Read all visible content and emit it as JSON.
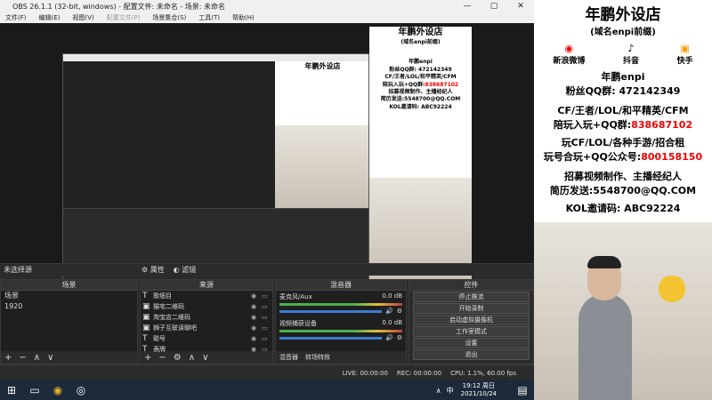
{
  "window": {
    "title": "OBS 26.1.1 (32-bit, windows) - 配置文件: 未命名 - 场景: 未命名",
    "minimize": "—",
    "maximize": "▢",
    "close": "✕"
  },
  "menu": [
    "文件(F)",
    "编辑(E)",
    "视图(V)",
    "配置文件(P)",
    "场景集合(S)",
    "工具(T)",
    "帮助(H)"
  ],
  "status_strip": {
    "no_source": "未选择源",
    "properties": "属性",
    "filters": "滤镜"
  },
  "scenes": {
    "title": "场景",
    "items": [
      "场景",
      "1920"
    ]
  },
  "sources": {
    "title": "来源",
    "items": [
      {
        "icon": "T",
        "label": "歌细目"
      },
      {
        "icon": "▣",
        "label": "猫宅二维码"
      },
      {
        "icon": "▣",
        "label": "淘宝店二维码"
      },
      {
        "icon": "▣",
        "label": "狮子互联读聊吧"
      },
      {
        "icon": "T",
        "label": "聪号"
      },
      {
        "icon": "T",
        "label": "表牌"
      }
    ]
  },
  "mixer": {
    "title": "混音器",
    "channels": [
      {
        "name": "麦克风/Aux",
        "db": "0.0 dB"
      },
      {
        "name": "视频捕获设备",
        "db": "0.0 dB"
      }
    ],
    "tab1": "混音器",
    "tab2": "转场特效"
  },
  "controls": {
    "title": "控件",
    "buttons": [
      "停止推流",
      "开始录制",
      "启动虚拟摄像机",
      "工作室模式",
      "设置",
      "退出"
    ]
  },
  "statusbar": {
    "live": "LIVE: 00:00:00",
    "rec": "REC: 00:00:00",
    "cpu": "CPU: 1.1%, 60.00 fps"
  },
  "ad": {
    "shop": "年鹏外设店",
    "domain": "(域名enpi前缀)",
    "weibo": "新浪微博",
    "douyin": "抖音",
    "kuaishou": "快手",
    "nianpeng": "年鹏enpi",
    "fans_qq": "粉丝QQ群: 472142349",
    "games": "CF/王者/LOL/和平精英/CFM",
    "play_qq_label": "陪玩入玩+QQ群:",
    "play_qq": "838687102",
    "games2": "玩CF/LOL/各种手游/招合租",
    "account_label": "玩号合玩+QQ公众号:",
    "account": "800158150",
    "recruit": "招募视频制作、主播经纪人",
    "email": "简历发送:5548700@QQ.COM",
    "kol": "KOL邀请码: ABC92224"
  },
  "taskbar": {
    "time": "19:12 周日",
    "date": "2021/10/24",
    "ime": "中"
  }
}
